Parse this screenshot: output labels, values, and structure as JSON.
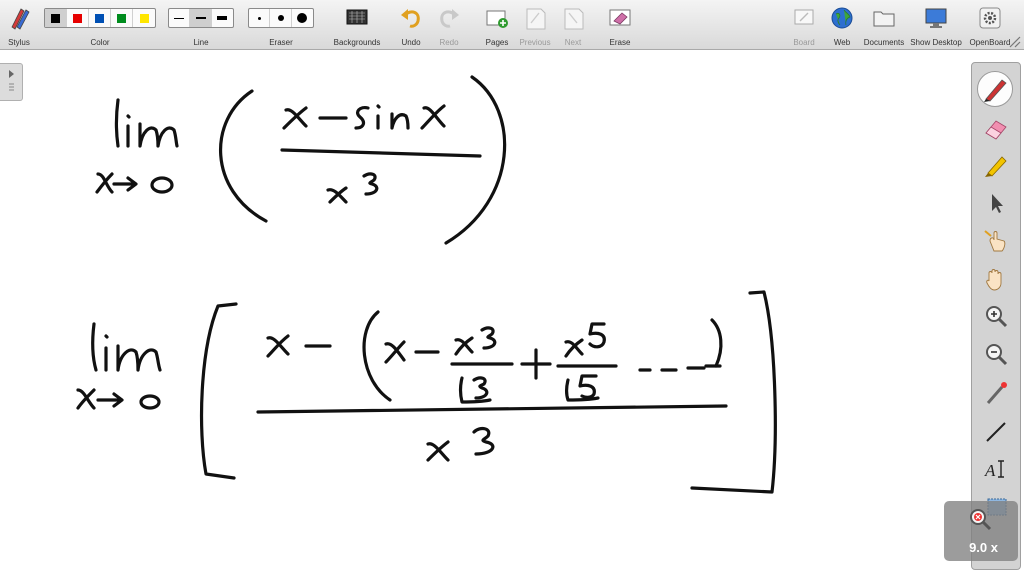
{
  "toolbar": {
    "stylus": "Stylus",
    "color": "Color",
    "colors": [
      "#000000",
      "#e60000",
      "#0050b4",
      "#008c1e",
      "#ffe600"
    ],
    "line": "Line",
    "eraser": "Eraser",
    "backgrounds": "Backgrounds",
    "undo": "Undo",
    "redo": "Redo",
    "pages": "Pages",
    "previous": "Previous",
    "next": "Next",
    "erase": "Erase",
    "board": "Board",
    "web": "Web",
    "documents": "Documents",
    "show_desktop": "Show Desktop",
    "openboard": "OpenBoard"
  },
  "palette": {
    "tools": [
      "pen-icon",
      "eraser-icon",
      "marker-icon",
      "selector-icon",
      "interact-icon",
      "hand-icon",
      "zoom-in-icon",
      "zoom-out-icon",
      "laser-pointer-icon",
      "line-icon",
      "text-icon",
      "capture-icon"
    ],
    "zoom_label": "9.0 x"
  }
}
